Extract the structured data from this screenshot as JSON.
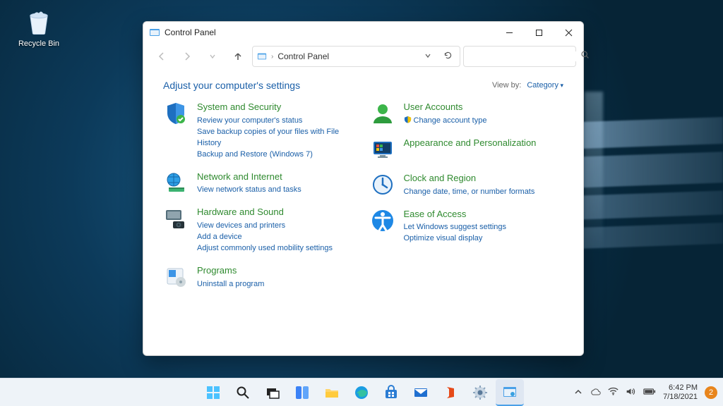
{
  "desktop": {
    "recycle_bin": "Recycle Bin"
  },
  "window": {
    "title": "Control Panel",
    "breadcrumb": "Control Panel",
    "headline": "Adjust your computer's settings",
    "viewby_label": "View by:",
    "viewby_value": "Category",
    "categories_left": [
      {
        "title": "System and Security",
        "links": [
          "Review your computer's status",
          "Save backup copies of your files with File History",
          "Backup and Restore (Windows 7)"
        ]
      },
      {
        "title": "Network and Internet",
        "links": [
          "View network status and tasks"
        ]
      },
      {
        "title": "Hardware and Sound",
        "links": [
          "View devices and printers",
          "Add a device",
          "Adjust commonly used mobility settings"
        ]
      },
      {
        "title": "Programs",
        "links": [
          "Uninstall a program"
        ]
      }
    ],
    "categories_right": [
      {
        "title": "User Accounts",
        "links": [
          "Change account type"
        ],
        "shield_on_first": true
      },
      {
        "title": "Appearance and Personalization",
        "links": []
      },
      {
        "title": "Clock and Region",
        "links": [
          "Change date, time, or number formats"
        ]
      },
      {
        "title": "Ease of Access",
        "links": [
          "Let Windows suggest settings",
          "Optimize visual display"
        ]
      }
    ]
  },
  "tray": {
    "time": "6:42 PM",
    "date": "7/18/2021",
    "notif_count": "2"
  }
}
